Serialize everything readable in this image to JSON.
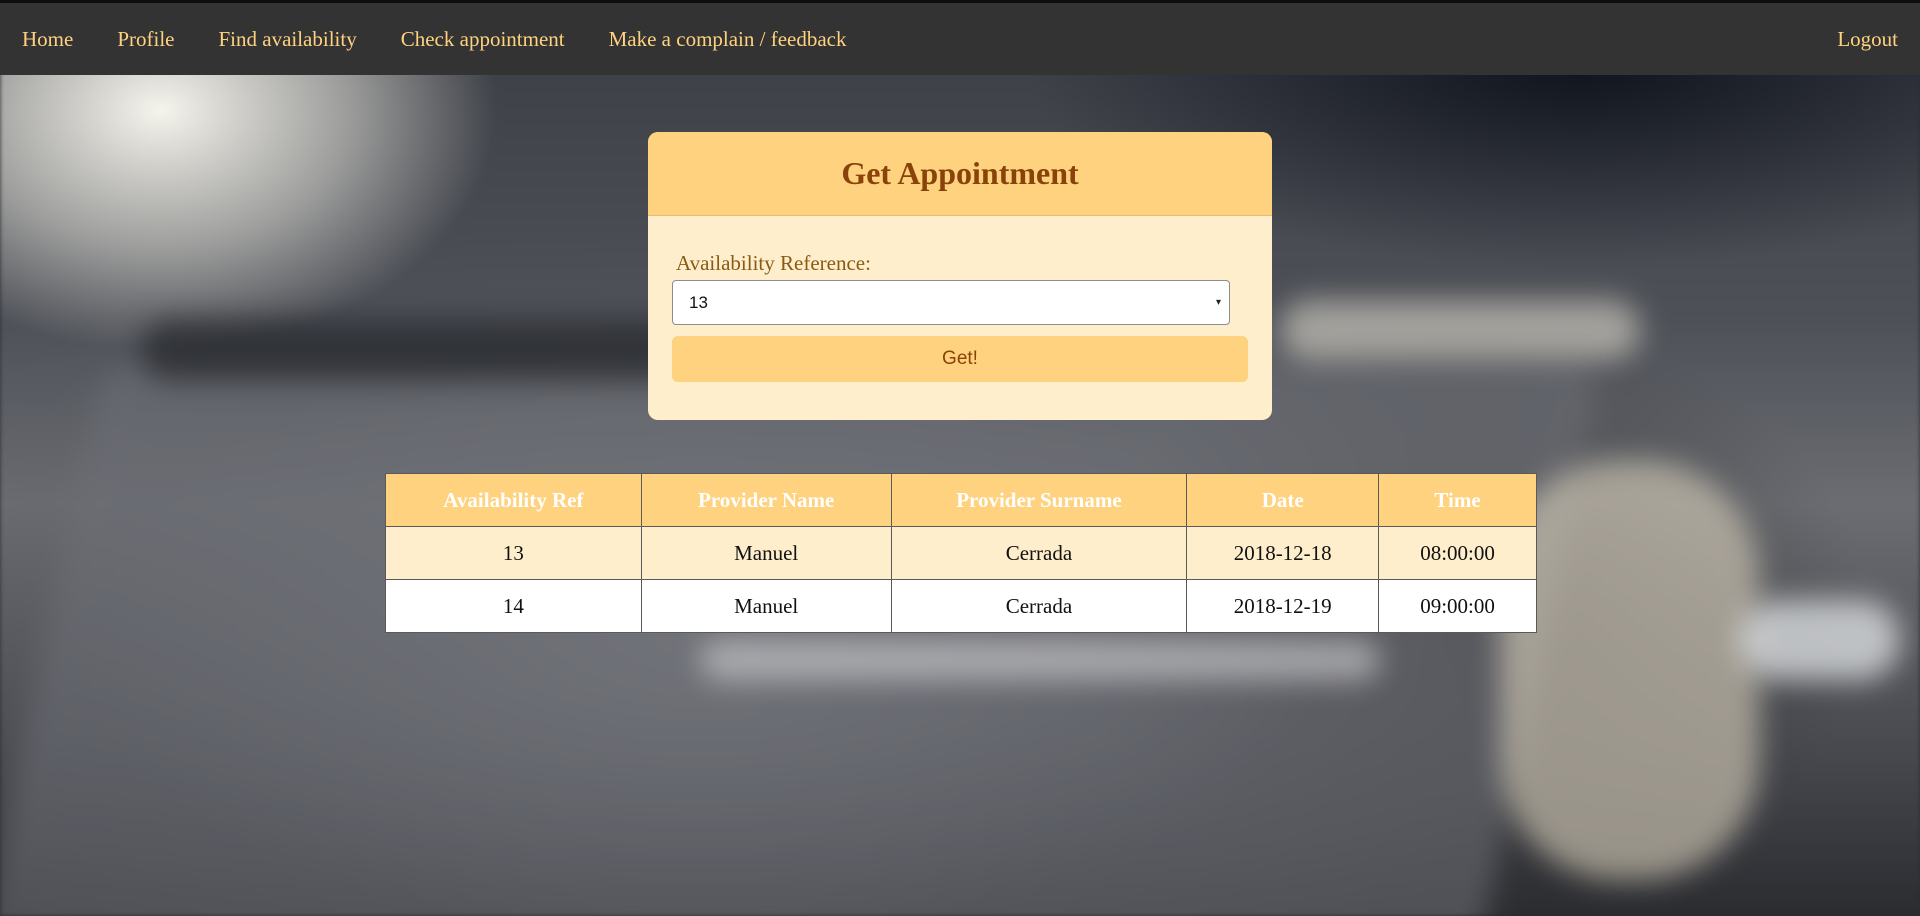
{
  "nav": {
    "items": [
      {
        "label": "Home"
      },
      {
        "label": "Profile"
      },
      {
        "label": "Find availability"
      },
      {
        "label": "Check appointment"
      },
      {
        "label": "Make a complain / feedback"
      }
    ],
    "logout": "Logout"
  },
  "card": {
    "title": "Get Appointment",
    "field_label": "Availability Reference:",
    "select_value": "13",
    "select_arrow": "▾",
    "button_label": "Get!"
  },
  "table": {
    "headers": [
      "Availability Ref",
      "Provider Name",
      "Provider Surname",
      "Date",
      "Time"
    ],
    "rows": [
      [
        "13",
        "Manuel",
        "Cerrada",
        "2018-12-18",
        "08:00:00"
      ],
      [
        "14",
        "Manuel",
        "Cerrada",
        "2018-12-19",
        "09:00:00"
      ]
    ]
  },
  "colors": {
    "navbar_bg": "#333333",
    "nav_text": "#ffd27f",
    "accent": "#ffd27f",
    "card_bg": "#ffeecc",
    "title_text": "#8a420b"
  }
}
